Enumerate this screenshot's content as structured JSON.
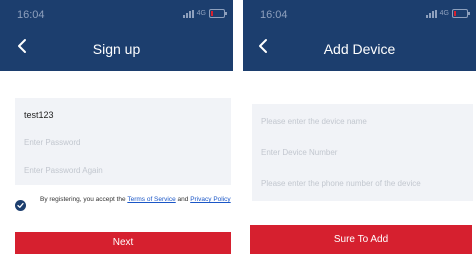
{
  "signup": {
    "status_time": "16:04",
    "network": "4G",
    "title": "Sign up",
    "username_value": "test123",
    "password_placeholder": "Enter Password",
    "password_again_placeholder": "Enter Password Again",
    "agreement_prefix": "By registering, you accept the ",
    "terms_link": "Terms of Service",
    "agreement_and": " and ",
    "privacy_link": "Privacy Policy",
    "next_label": "Next"
  },
  "add_device": {
    "status_time": "16:04",
    "network": "4G",
    "title": "Add Device",
    "device_name_placeholder": "Please enter the device name",
    "device_number_placeholder": "Enter Device Number",
    "phone_placeholder": "Please enter the phone number of the device",
    "submit_label": "Sure To Add"
  },
  "icons": {
    "back": "chevron-left-icon",
    "check": "checkmark-icon",
    "signal": "signal-bars-icon",
    "battery": "battery-icon"
  },
  "colors": {
    "header": "#1c3e6e",
    "accent": "#d6202f",
    "field_bg": "#f1f3f7",
    "link": "#1a56c7"
  },
  "battery_level_percent": 20
}
